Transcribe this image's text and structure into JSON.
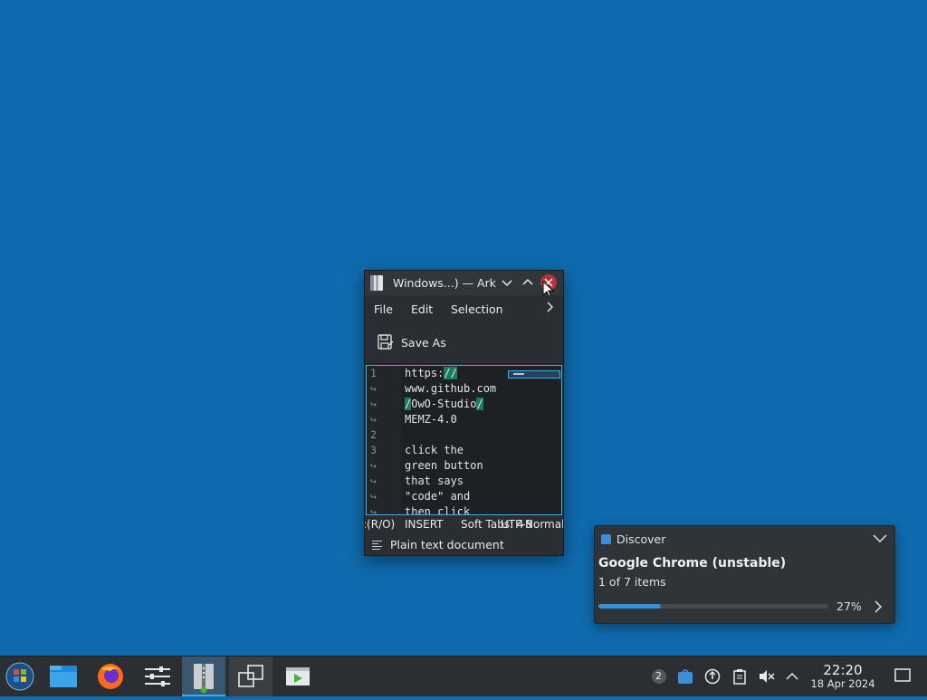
{
  "colors": {
    "desktop": "#0f6bae",
    "accent": "#3daee9",
    "close": "#b0343a",
    "highlight": "#1d7b63"
  },
  "window": {
    "title": "Windows...) — Ark",
    "menu": {
      "file": "File",
      "edit": "Edit",
      "selection": "Selection",
      "more": ">"
    },
    "toolbar": {
      "save_as": "Save As"
    },
    "editor": {
      "lines": [
        {
          "num": "1",
          "text": "https://"
        },
        {
          "num": "↪",
          "text": "www.github.com"
        },
        {
          "num": "↪",
          "text": "/OwO-Studio/"
        },
        {
          "num": "↪",
          "text": "MEMZ-4.0"
        },
        {
          "num": "2",
          "text": ""
        },
        {
          "num": "3",
          "text": "click the"
        },
        {
          "num": "↪",
          "text": "green button"
        },
        {
          "num": "↪",
          "text": "that says"
        },
        {
          "num": "↪",
          "text": "\"code\" and"
        },
        {
          "num": "↪",
          "text": "then click"
        }
      ]
    },
    "status": {
      "mode": ":(R/O)",
      "insert": "INSERT",
      "tabs": "Soft Tabs: 4",
      "encoding": "UTF-8",
      "normal": "Normal"
    },
    "doctype": "Plain text document"
  },
  "notification": {
    "app": "Discover",
    "title": "Google Chrome (unstable)",
    "items": "1 of 7 items",
    "progress_percent": 27,
    "progress_label": "27%"
  },
  "taskbar": {
    "apps": [
      "application-launcher-icon",
      "file-manager-icon",
      "firefox-icon",
      "settings-icon",
      "ark-icon",
      "desktop-icon",
      "media-player-icon"
    ],
    "tray": {
      "updates_count": "2"
    },
    "clock": {
      "time": "22:20",
      "date": "18 Apr 2024"
    }
  }
}
